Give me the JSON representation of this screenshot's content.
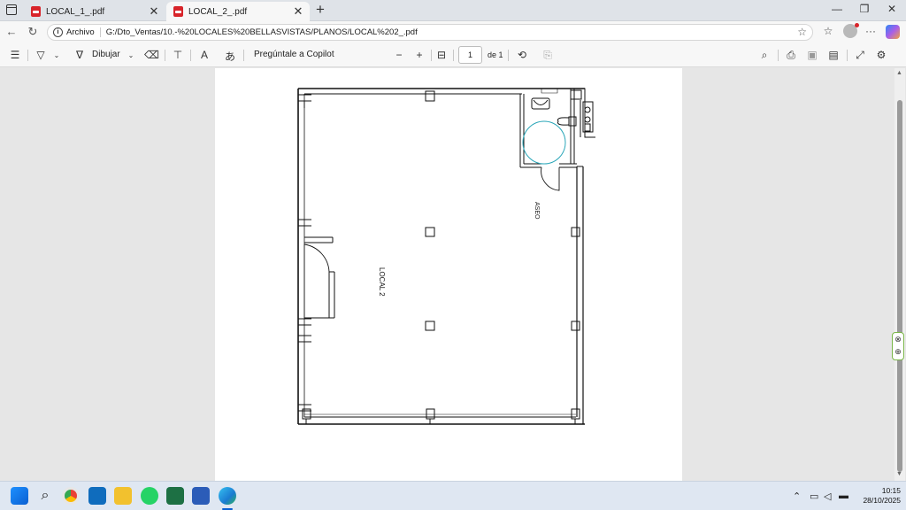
{
  "tabs": [
    {
      "title": "LOCAL_1_.pdf",
      "active": false
    },
    {
      "title": "LOCAL_2_.pdf",
      "active": true
    }
  ],
  "address": {
    "scheme_label": "Archivo",
    "url": "G:/Dto_Ventas/10.-%20LOCALES%20BELLASVISTAS/PLANOS/LOCAL%202_.pdf"
  },
  "pdf_toolbar": {
    "draw_label": "Dibujar",
    "copilot_label": "Pregúntale a Copilot",
    "page_current": "1",
    "page_total_label": "de 1"
  },
  "document": {
    "room_local_label": "LOCAL 2",
    "room_aseo_label": "ASEO"
  },
  "taskbar": {
    "time": "10:15",
    "date": "28/10/2025"
  },
  "colors": {
    "pdf_red": "#d8242a",
    "accent_green": "#7ab648",
    "annotation_teal": "#2aa6b8"
  },
  "icons": [
    "windows-start-icon",
    "search-icon",
    "chrome-icon",
    "outlook-icon",
    "file-explorer-icon",
    "whatsapp-icon",
    "excel-icon",
    "word-icon",
    "edge-icon"
  ]
}
